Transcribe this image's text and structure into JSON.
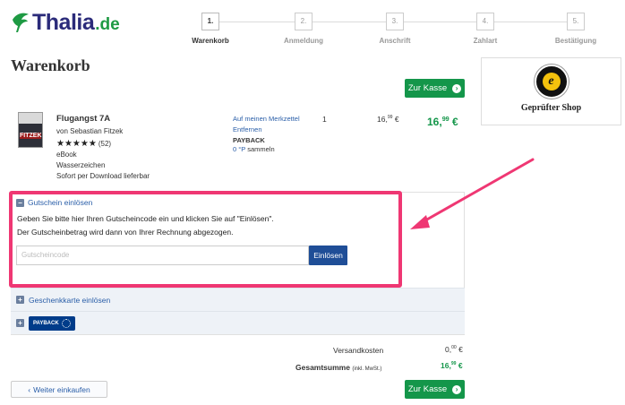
{
  "brand": {
    "name": "Thalia",
    "suffix": ".de",
    "color_primary": "#2b2b7a",
    "color_accent": "#1e9a43",
    "logo_icon": "bird-logo-icon"
  },
  "stepper": {
    "steps": [
      {
        "num": "1.",
        "label": "Warenkorb",
        "active": true
      },
      {
        "num": "2.",
        "label": "Anmeldung",
        "active": false
      },
      {
        "num": "3.",
        "label": "Anschrift",
        "active": false
      },
      {
        "num": "4.",
        "label": "Zahlart",
        "active": false
      },
      {
        "num": "5.",
        "label": "Bestätigung",
        "active": false
      }
    ]
  },
  "page_title": "Warenkorb",
  "checkout_button": {
    "label": "Zur Kasse",
    "icon": "chevron-right-icon",
    "color": "#14964a"
  },
  "trusted_shop": {
    "label": "Geprüfter Shop",
    "seal_letter": "e",
    "icon": "trusted-shops-seal-icon"
  },
  "product": {
    "cover_title": "FITZEK",
    "title": "Flugangst 7A",
    "author": "von Sebastian Fitzek",
    "stars": "★★★★★",
    "rating_count": "(52)",
    "format": "eBook",
    "drm": "Wasserzeichen",
    "availability": "Sofort per Download lieferbar",
    "wishlist_link": "Auf meinen Merkzettel",
    "remove_link": "Entfernen",
    "payback_label": "PAYBACK",
    "points_value": "0 °P",
    "points_suffix": "sammeln",
    "quantity": "1",
    "unit_price_main": "16,",
    "unit_price_cents": "99",
    "unit_price_currency": "€",
    "total_price_main": "16,",
    "total_price_cents": "99",
    "total_price_currency": "€"
  },
  "voucher": {
    "heading": "Gutschein einlösen",
    "toggle_symbol": "−",
    "line1": "Geben Sie bitte hier Ihren Gutscheincode ein und klicken Sie auf \"Einlösen\".",
    "line2": "Der Gutscheinbetrag wird dann von Ihrer Rechnung abgezogen.",
    "placeholder": "Gutscheincode",
    "button": "Einlösen",
    "highlight_color": "#ef3773"
  },
  "giftcard": {
    "label": "Geschenkkarte einlösen",
    "toggle_symbol": "+"
  },
  "payback_section": {
    "toggle_symbol": "+",
    "badge_text": "PAYBACK"
  },
  "totals": {
    "shipping_label": "Versandkosten",
    "shipping_main": "0,",
    "shipping_cents": "00",
    "shipping_currency": "€",
    "sum_label": "Gesamtsumme",
    "sum_note": "(inkl. MwSt.)",
    "sum_main": "16,",
    "sum_cents": "99",
    "sum_currency": "€"
  },
  "back_button": {
    "label": "Weiter einkaufen",
    "icon": "chevron-left-icon"
  }
}
